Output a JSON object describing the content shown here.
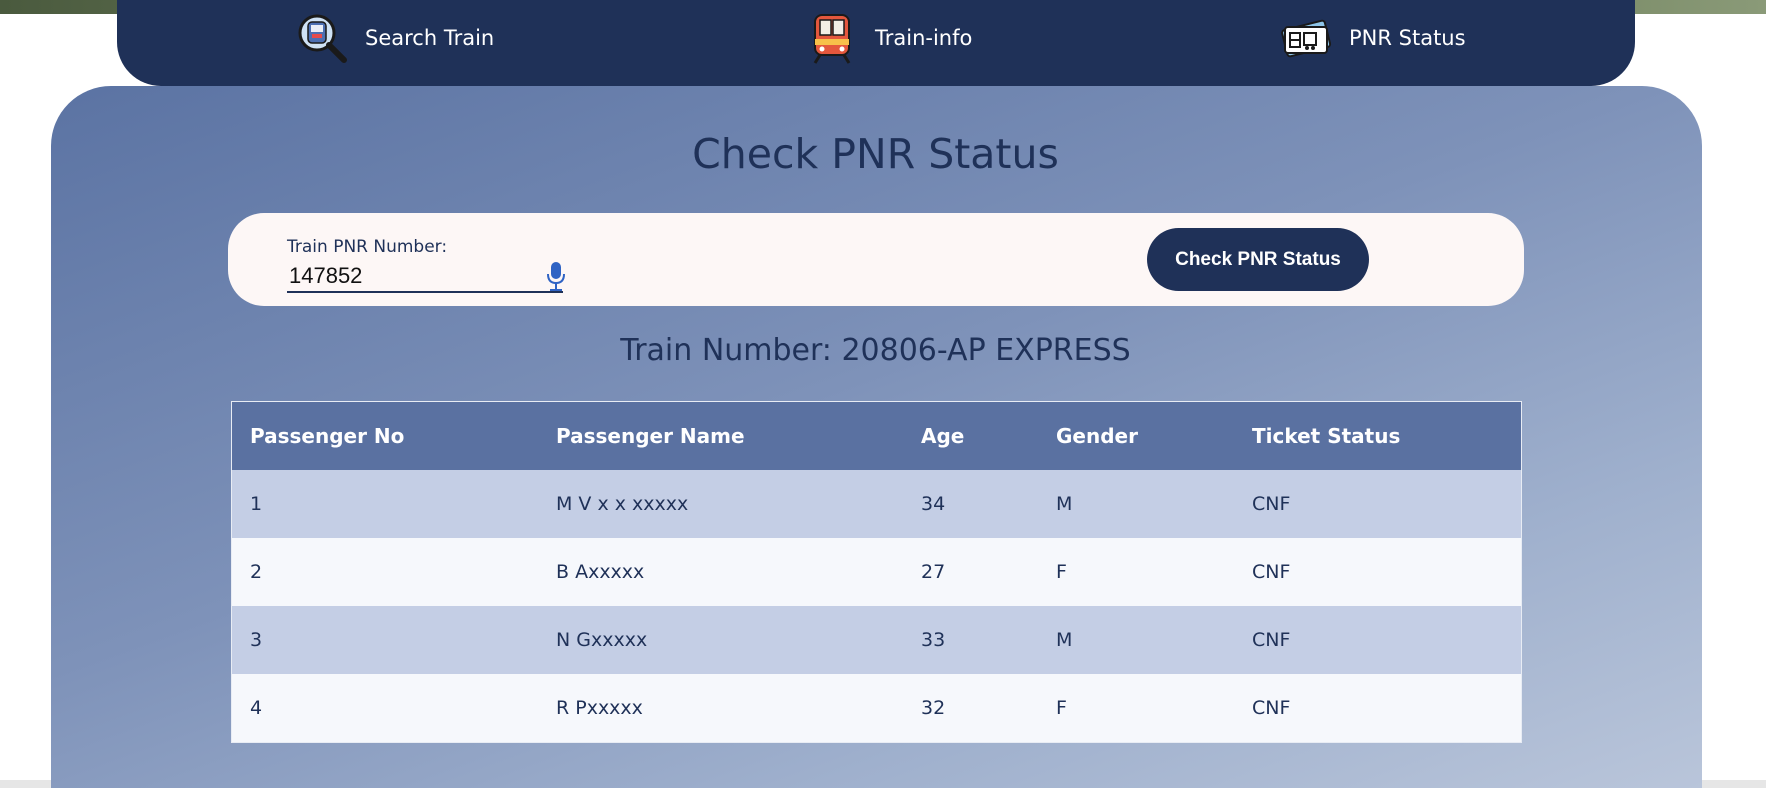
{
  "nav": {
    "items": [
      {
        "label": "Search Train",
        "icon": "train-search-icon"
      },
      {
        "label": "Train-info",
        "icon": "train-front-icon"
      },
      {
        "label": "PNR Status",
        "icon": "ticket-icon"
      }
    ]
  },
  "main": {
    "title": "Check PNR Status",
    "input_label": "Train PNR Number:",
    "input_value": "147852",
    "mic_icon": "microphone-icon",
    "button_label": "Check PNR Status",
    "train_number": "Train Number: 20806-AP EXPRESS"
  },
  "table": {
    "headers": [
      "Passenger No",
      "Passenger Name",
      "Age",
      "Gender",
      "Ticket Status"
    ],
    "rows": [
      [
        "1",
        "M V x x xxxxx",
        "34",
        "M",
        "CNF"
      ],
      [
        "2",
        "B Axxxxx",
        "27",
        "F",
        "CNF"
      ],
      [
        "3",
        "N Gxxxxx",
        "33",
        "M",
        "CNF"
      ],
      [
        "4",
        "R Pxxxxx",
        "32",
        "F",
        "CNF"
      ]
    ]
  },
  "colors": {
    "navy": "#1f3158",
    "header_row": "#5a71a1",
    "row_alt": "#c4cee5",
    "row_light": "#f6f8fc",
    "card": "#fdf7f6"
  }
}
